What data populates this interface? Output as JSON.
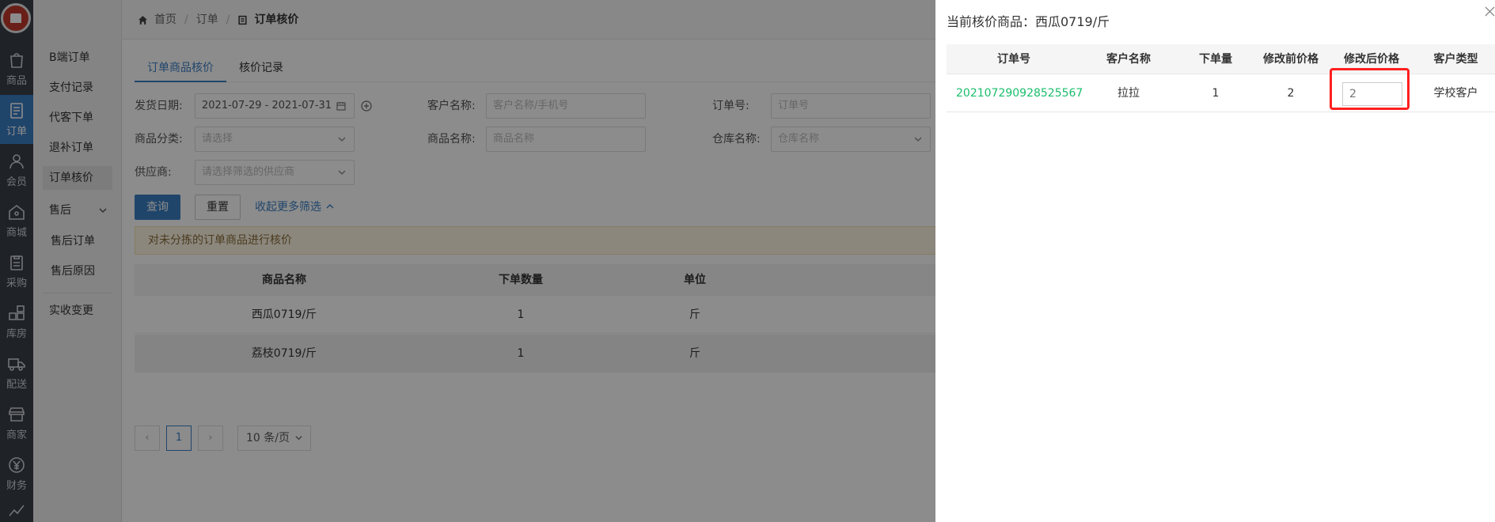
{
  "nav": {
    "items": [
      {
        "label": "商品",
        "icon": "bag-icon"
      },
      {
        "label": "订单",
        "icon": "document-icon"
      },
      {
        "label": "会员",
        "icon": "user-icon"
      },
      {
        "label": "商城",
        "icon": "home-icon"
      },
      {
        "label": "采购",
        "icon": "clipboard-icon"
      },
      {
        "label": "库房",
        "icon": "warehouse-icon"
      },
      {
        "label": "配送",
        "icon": "truck-icon"
      },
      {
        "label": "商家",
        "icon": "store-icon"
      },
      {
        "label": "财务",
        "icon": "yen-icon"
      }
    ],
    "active_color": "#3b7fc4"
  },
  "submenu": {
    "items": [
      "B端订单",
      "支付记录",
      "代客下单",
      "退补订单",
      "订单核价"
    ],
    "aftersale_group": "售后",
    "aftersale_items": [
      "售后订单",
      "售后原因"
    ],
    "extra_item": "实收变更"
  },
  "breadcrumb": {
    "home": "首页",
    "level1": "订单",
    "current": "订单核价"
  },
  "tabs": [
    "订单商品核价",
    "核价记录"
  ],
  "filters": {
    "ship_date_label": "发货日期:",
    "ship_date_value": "2021-07-29 - 2021-07-31",
    "customer_label": "客户名称:",
    "customer_placeholder": "客户名称/手机号",
    "order_no_label": "订单号:",
    "order_no_placeholder": "订单号",
    "category_label": "商品分类:",
    "category_placeholder": "请选择",
    "product_label": "商品名称:",
    "product_placeholder": "商品名称",
    "warehouse_label": "仓库名称:",
    "warehouse_placeholder": "仓库名称",
    "supplier_label": "供应商:",
    "supplier_placeholder": "请选择筛选的供应商",
    "query_button": "查询",
    "reset_button": "重置",
    "collapse_link": "收起更多筛选"
  },
  "notice": "对未分拣的订单商品进行核价",
  "table": {
    "headers": [
      "商品名称",
      "下单数量",
      "单位"
    ],
    "rows": [
      [
        "西瓜0719/斤",
        "1",
        "斤"
      ],
      [
        "荔枝0719/斤",
        "1",
        "斤"
      ]
    ]
  },
  "pagination": {
    "prev": "‹",
    "page": "1",
    "next": "›",
    "page_size": "10 条/页"
  },
  "drawer": {
    "title": "当前核价商品：西瓜0719/斤",
    "headers": [
      "订单号",
      "客户名称",
      "下单量",
      "修改前价格",
      "修改后价格",
      "客户类型"
    ],
    "row": {
      "order_no": "202107290928525567",
      "customer": "拉拉",
      "quantity": "1",
      "price_before": "2",
      "price_after_placeholder": "2",
      "customer_type": "学校客户"
    },
    "order_no_color": "#19be6b",
    "highlight_color": "#ff1f1f"
  }
}
